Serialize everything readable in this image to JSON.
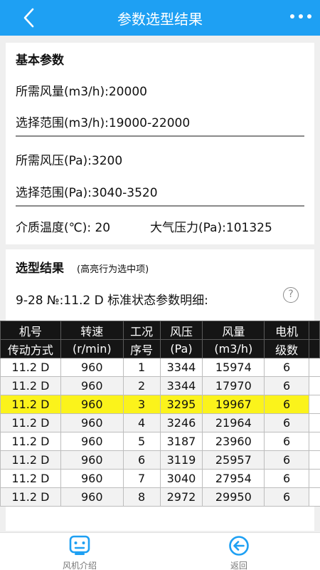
{
  "header": {
    "title": "参数选型结果",
    "back_icon": "chevron-left-icon",
    "more_icon": "more-horizontal-icon"
  },
  "basic": {
    "section_title": "基本参数",
    "airflow": "所需风量(m3/h):20000",
    "airflow_range": "选择范围(m3/h):19000-22000",
    "pressure": "所需风压(Pa):3200",
    "pressure_range": "选择范围(Pa):3040-3520",
    "temperature": "介质温度(℃): 20",
    "atm_pressure": "大气压力(Pa):101325"
  },
  "result": {
    "section_title": "选型结果",
    "hint": "(高亮行为选中项)",
    "model_line": "9-28 №:11.2 D 标准状态参数明细:",
    "help_icon": "question-circle-icon",
    "highlight_color": "#fbf31b",
    "columns": [
      {
        "line1": "机号",
        "line2": "传动方式"
      },
      {
        "line1": "转速",
        "line2": "(r/min)"
      },
      {
        "line1": "工况",
        "line2": "序号"
      },
      {
        "line1": "风压",
        "line2": "(Pa)"
      },
      {
        "line1": "风量",
        "line2": "(m3/h)"
      },
      {
        "line1": "电机",
        "line2": "级数"
      }
    ],
    "rows": [
      {
        "model": "11.2 D",
        "speed": "960",
        "seq": "1",
        "pressure": "3344",
        "flow": "15974",
        "poles": "6",
        "selected": false
      },
      {
        "model": "11.2 D",
        "speed": "960",
        "seq": "2",
        "pressure": "3344",
        "flow": "17970",
        "poles": "6",
        "selected": false
      },
      {
        "model": "11.2 D",
        "speed": "960",
        "seq": "3",
        "pressure": "3295",
        "flow": "19967",
        "poles": "6",
        "selected": true
      },
      {
        "model": "11.2 D",
        "speed": "960",
        "seq": "4",
        "pressure": "3246",
        "flow": "21964",
        "poles": "6",
        "selected": false
      },
      {
        "model": "11.2 D",
        "speed": "960",
        "seq": "5",
        "pressure": "3187",
        "flow": "23960",
        "poles": "6",
        "selected": false
      },
      {
        "model": "11.2 D",
        "speed": "960",
        "seq": "6",
        "pressure": "3119",
        "flow": "25957",
        "poles": "6",
        "selected": false
      },
      {
        "model": "11.2 D",
        "speed": "960",
        "seq": "7",
        "pressure": "3040",
        "flow": "27954",
        "poles": "6",
        "selected": false
      },
      {
        "model": "11.2 D",
        "speed": "960",
        "seq": "8",
        "pressure": "2972",
        "flow": "29950",
        "poles": "6",
        "selected": false
      }
    ]
  },
  "bottom_nav": {
    "left_label": "风机介绍",
    "left_icon": "fan-intro-icon",
    "right_label": "返回",
    "right_icon": "back-circle-icon",
    "accent": "#1ea0f3"
  }
}
